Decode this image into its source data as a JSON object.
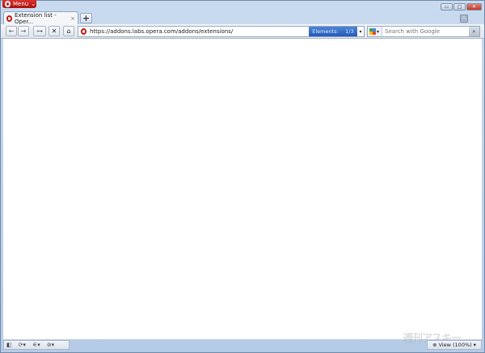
{
  "menu": {
    "label": "Menu"
  },
  "tab": {
    "title": "Extension list - Oper...",
    "close": "×"
  },
  "new_tab": "+",
  "window_controls": {
    "minimize": "▭",
    "maximize": "□",
    "close": "✕"
  },
  "toolbar": {
    "back": "←",
    "forward": "→",
    "wand": "⊶",
    "stop": "✕",
    "home": "⌂"
  },
  "address": {
    "url": "https://addons.labs.opera.com/addons/extensions/",
    "elements_label": "Elements:",
    "elements_count": "1/3",
    "dropdown": "▾"
  },
  "search": {
    "placeholder": "Search with Google",
    "engine_dropdown": "▾",
    "go": "⌕"
  },
  "status_bar": {
    "panel": "◧",
    "sync": "⟳▾",
    "unite": "⚟▾",
    "turbo": "⊚▾",
    "view_label": "View (100%)",
    "view_dropdown": "▾"
  },
  "watermark": "週刊アスキー"
}
